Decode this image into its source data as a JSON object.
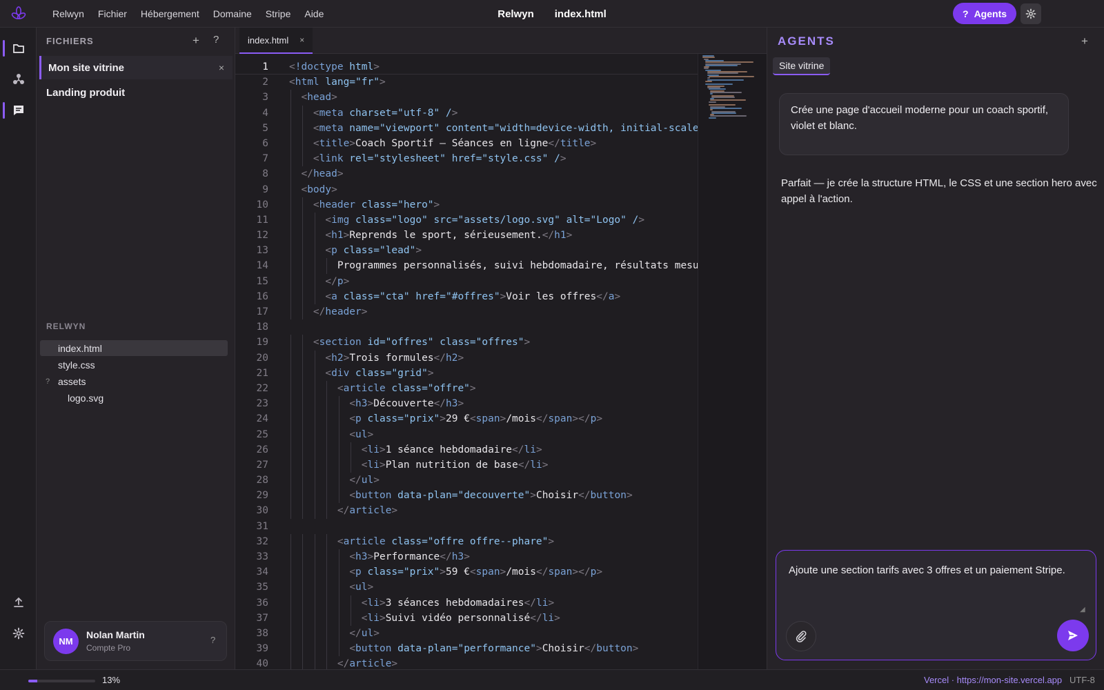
{
  "topbar": {
    "menu": [
      "Relwyn",
      "Fichier",
      "Hébergement",
      "Domaine",
      "Stripe",
      "Aide"
    ],
    "app_name": "Relwyn",
    "file_name": "index.html",
    "agents_label": "Agents",
    "agents_icon": "?"
  },
  "sidebar": {
    "header": "FICHIERS",
    "add": "+",
    "help": "?",
    "projects": [
      {
        "label": "Mon site vitrine",
        "close": "×"
      },
      {
        "label": "Landing produit"
      }
    ],
    "section": "RELWYN",
    "files": [
      {
        "label": "index.html"
      },
      {
        "label": "style.css"
      },
      {
        "label": "assets",
        "marker": "?"
      },
      {
        "label": "logo.svg"
      }
    ],
    "user": {
      "initials": "NM",
      "name": "Nolan Martin",
      "plan": "Compte Pro",
      "help": "?"
    }
  },
  "editor": {
    "tab": {
      "label": "index.html",
      "close": "×"
    },
    "lines": [
      "1",
      "2",
      "3",
      "4",
      "5",
      "6",
      "7",
      "8",
      "9",
      "10",
      "11",
      "12",
      "13",
      "14",
      "15",
      "16",
      "17",
      "18",
      "19",
      "20",
      "21",
      "22",
      "23",
      "24",
      "25",
      "26",
      "27",
      "28",
      "29",
      "30",
      "31",
      "32",
      "33",
      "34",
      "35",
      "36",
      "37",
      "38",
      "39",
      "40"
    ],
    "code": [
      "<!doctype html>",
      "<html lang=\"fr\">",
      "  <head>",
      "    <meta charset=\"utf-8\" />",
      "    <meta name=\"viewport\" content=\"width=device-width, initial-scale",
      "    <title>Coach Sportif — Séances en ligne</title>",
      "    <link rel=\"stylesheet\" href=\"style.css\" />",
      "  </head>",
      "  <body>",
      "    <header class=\"hero\">",
      "      <img class=\"logo\" src=\"assets/logo.svg\" alt=\"Logo\" />",
      "      <h1>Reprends le sport, sérieusement.</h1>",
      "      <p class=\"lead\">",
      "        Programmes personnalisés, suivi hebdomadaire, résultats mesu",
      "      </p>",
      "      <a class=\"cta\" href=\"#offres\">Voir les offres</a>",
      "    </header>",
      "",
      "    <section id=\"offres\" class=\"offres\">",
      "      <h2>Trois formules</h2>",
      "      <div class=\"grid\">",
      "        <article class=\"offre\">",
      "          <h3>Découverte</h3>",
      "          <p class=\"prix\">29 €<span>/mois</span></p>",
      "          <ul>",
      "            <li>1 séance hebdomadaire</li>",
      "            <li>Plan nutrition de base</li>",
      "          </ul>",
      "          <button data-plan=\"decouverte\">Choisir</button>",
      "        </article>",
      "",
      "        <article class=\"offre offre--phare\">",
      "          <h3>Performance</h3>",
      "          <p class=\"prix\">59 €<span>/mois</span></p>",
      "          <ul>",
      "            <li>3 séances hebdomadaires</li>",
      "            <li>Suivi vidéo personnalisé</li>",
      "          </ul>",
      "          <button data-plan=\"performance\">Choisir</button>",
      "        </article>"
    ]
  },
  "agents_panel": {
    "title": "AGENTS",
    "add": "+",
    "tab": "Site vitrine",
    "user_message": "Crée une page d'accueil moderne pour un coach sportif, violet et blanc.",
    "assistant_message": "Parfait — je crée la structure HTML, le CSS et une section hero avec appel à l'action.",
    "composer_text": "Ajoute une section tarifs avec 3 offres et un paiement Stripe."
  },
  "statusbar": {
    "progress": 0.13,
    "percent": "13%",
    "deploy": "Vercel · https://mon-site.vercel.app",
    "encoding": "UTF-8"
  },
  "colors": {
    "accent": "#7c3aed",
    "accent_light": "#a78bfa",
    "bg": "#1f1d21",
    "panel": "#262328"
  }
}
